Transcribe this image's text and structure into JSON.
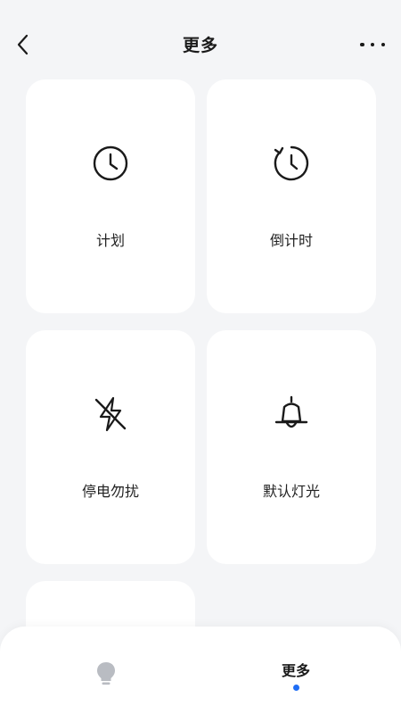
{
  "header": {
    "title": "更多",
    "back_icon": "chevron-left-icon",
    "more_icon": "more-horizontal-icon"
  },
  "cards": [
    {
      "label": "计划",
      "icon": "clock-icon"
    },
    {
      "label": "倒计时",
      "icon": "countdown-timer-icon"
    },
    {
      "label": "停电勿扰",
      "icon": "power-off-icon"
    },
    {
      "label": "默认灯光",
      "icon": "bell-icon"
    }
  ],
  "tabbar": {
    "lamp_icon": "light-bulb-icon",
    "more_label": "更多",
    "active_color": "#1e6df5"
  },
  "colors": {
    "background": "#f4f5f7",
    "card": "#ffffff",
    "accent": "#1e6df5"
  }
}
